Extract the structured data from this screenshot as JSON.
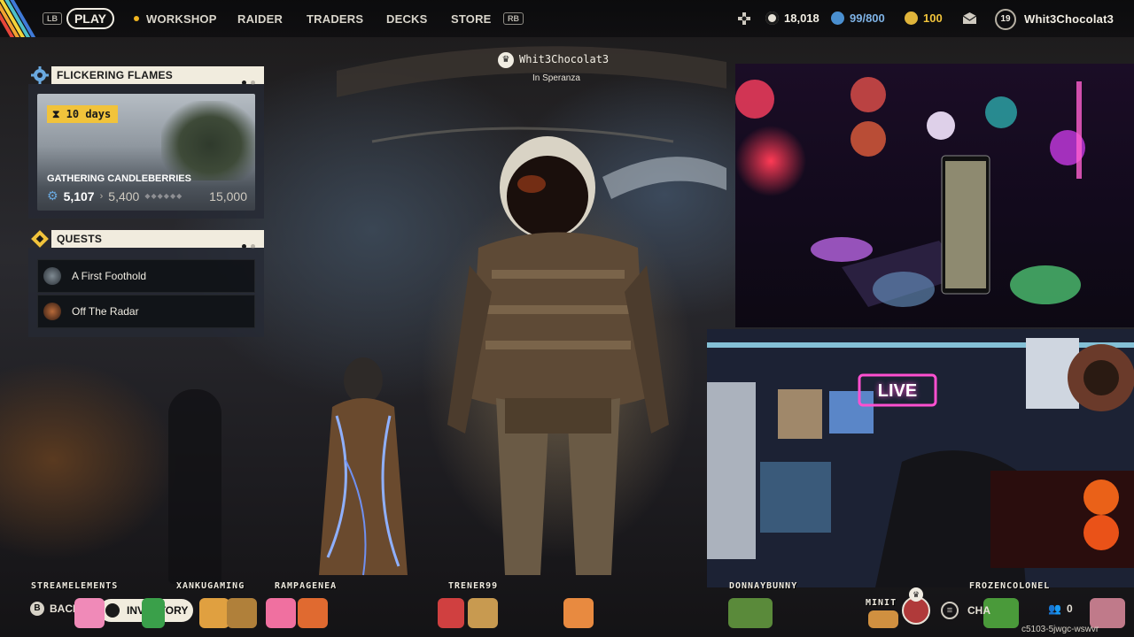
{
  "nav": {
    "lb_key": "LB",
    "rb_key": "RB",
    "play": "PLAY",
    "items": [
      "WORKSHOP",
      "RAIDER",
      "TRADERS",
      "DECKS",
      "STORE"
    ]
  },
  "status": {
    "credits": "18,018",
    "blue_coins": "99/800",
    "gold_coins": "100",
    "level": "19",
    "username": "Whit3Chocolat3"
  },
  "event": {
    "header": "FLICKERING FLAMES",
    "days_left": "10 days",
    "title": "GATHERING CANDLEBERRIES",
    "current": "5,107",
    "next_milestone": "5,400",
    "max": "15,000"
  },
  "quests": {
    "header": "QUESTS",
    "items": [
      "A First Foothold",
      "Off The Radar"
    ]
  },
  "player": {
    "name": "Whit3Chocolat3",
    "location": "In Speranza"
  },
  "stream_names": {
    "n1": "STREAMELEMENTS",
    "n2": "XANKUGAMING",
    "n3": "RAMPAGENEA",
    "n4": "TRENER99",
    "n5": "DONNAYBUNNY",
    "n6": "FROZENCOLONEL",
    "n7": "MINIT"
  },
  "bottom": {
    "back_key": "B",
    "back": "BACK",
    "inventory": "INVENTORY",
    "chat": "CHA",
    "party_count": "0",
    "code": "c5103-5jwgc-wswvr"
  },
  "webcam_sign": "LIVE",
  "colors": {
    "accent_yellow": "#f1c33b",
    "panel_cream": "#f1ecde",
    "blue_coin": "#4a8fd0",
    "gold_coin": "#e0b43a"
  }
}
